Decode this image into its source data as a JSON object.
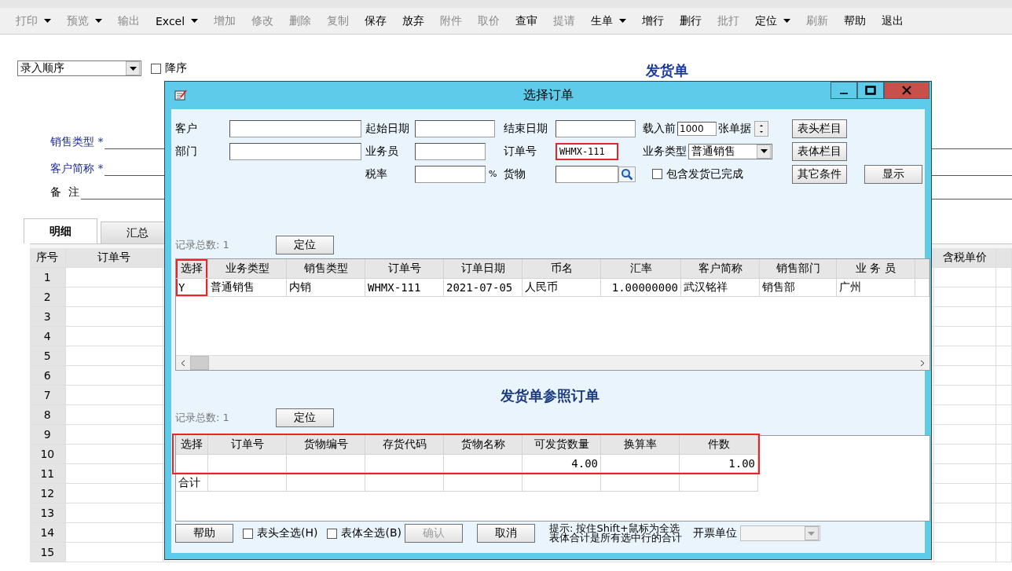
{
  "toolbar": [
    {
      "label": "打印",
      "disabled": true,
      "dropdown": true
    },
    {
      "label": "预览",
      "disabled": true,
      "dropdown": true
    },
    {
      "label": "输出",
      "disabled": true,
      "dropdown": false
    },
    {
      "label": "Excel",
      "disabled": false,
      "dropdown": true
    },
    {
      "label": "增加",
      "disabled": true,
      "dropdown": false
    },
    {
      "label": "修改",
      "disabled": true,
      "dropdown": false
    },
    {
      "label": "删除",
      "disabled": true,
      "dropdown": false
    },
    {
      "label": "复制",
      "disabled": true,
      "dropdown": false
    },
    {
      "label": "保存",
      "disabled": false,
      "dropdown": false
    },
    {
      "label": "放弃",
      "disabled": false,
      "dropdown": false
    },
    {
      "label": "附件",
      "disabled": true,
      "dropdown": false
    },
    {
      "label": "取价",
      "disabled": true,
      "dropdown": false
    },
    {
      "label": "查审",
      "disabled": false,
      "dropdown": false
    },
    {
      "label": "提请",
      "disabled": true,
      "dropdown": false
    },
    {
      "label": "生单",
      "disabled": false,
      "dropdown": true
    },
    {
      "label": "增行",
      "disabled": false,
      "dropdown": false
    },
    {
      "label": "删行",
      "disabled": false,
      "dropdown": false
    },
    {
      "label": "批打",
      "disabled": true,
      "dropdown": false
    },
    {
      "label": "定位",
      "disabled": false,
      "dropdown": true
    },
    {
      "label": "刷新",
      "disabled": true,
      "dropdown": false
    },
    {
      "label": "帮助",
      "disabled": false,
      "dropdown": false
    },
    {
      "label": "退出",
      "disabled": false,
      "dropdown": false
    }
  ],
  "sort": {
    "value": "录入顺序",
    "descending": {
      "label": "降序",
      "checked": false
    }
  },
  "document_title": "发货单",
  "form_fields": [
    {
      "label": "销售类型 *",
      "required": true
    },
    {
      "label": "客户简称 *",
      "required": true
    },
    {
      "label": "备  注",
      "required": false
    }
  ],
  "tabs": [
    {
      "label": "明细",
      "selected": true
    },
    {
      "label": "汇总",
      "selected": false
    }
  ],
  "grid": {
    "columns": [
      "序号",
      "订单号",
      "含税单价"
    ],
    "rows": [
      "1",
      "2",
      "3",
      "4",
      "5",
      "6",
      "7",
      "8",
      "9",
      "10",
      "11",
      "12",
      "13",
      "14",
      "15"
    ]
  },
  "dialog": {
    "title": "选择订单",
    "filter": {
      "customer": {
        "label": "客户"
      },
      "start_date": {
        "label": "起始日期"
      },
      "end_date": {
        "label": "结束日期"
      },
      "load_before": {
        "label": "载入前",
        "value": "1000",
        "unit": "张单据"
      },
      "department": {
        "label": "部门"
      },
      "salesman": {
        "label": "业务员"
      },
      "order_no": {
        "label": "订单号",
        "value": "WHMX-111",
        "highlighted": true
      },
      "biz_type": {
        "label": "业务类型",
        "value": "普通销售"
      },
      "tax_rate": {
        "label": "税率",
        "unit": "%"
      },
      "goods": {
        "label": "货物"
      },
      "include_done": {
        "label": "包含发货已完成",
        "checked": false
      },
      "buttons": [
        "表头栏目",
        "表体栏目",
        "其它条件",
        "显示"
      ]
    },
    "orders": {
      "record_count": "记录总数: 1",
      "locate_button": "定位",
      "columns": [
        {
          "label": "选择",
          "highlighted": true
        },
        {
          "label": "业务类型",
          "highlighted": false
        },
        {
          "label": "销售类型",
          "highlighted": false
        },
        {
          "label": "订单号",
          "highlighted": false
        },
        {
          "label": "订单日期",
          "highlighted": false
        },
        {
          "label": "币名",
          "highlighted": false
        },
        {
          "label": "汇率",
          "highlighted": false
        },
        {
          "label": "客户简称",
          "highlighted": false
        },
        {
          "label": "销售部门",
          "highlighted": false
        },
        {
          "label": "业 务 员",
          "highlighted": false
        }
      ],
      "rows": [
        {
          "cells": [
            "Y",
            "普通销售",
            "内销",
            "WHMX-111",
            "2021-07-05",
            "人民币",
            "1.00000000",
            "武汉铭祥",
            "销售部",
            "广州"
          ]
        }
      ]
    },
    "section_title": "发货单参照订单",
    "details": {
      "record_count": "记录总数: 1",
      "locate_button": "定位",
      "highlighted": true,
      "columns": [
        "选择",
        "订单号",
        "货物编号",
        "存货代码",
        "货物名称",
        "可发货数量",
        "换算率",
        "件数"
      ],
      "rows": [
        {
          "available_qty": "4.00",
          "pieces": "1.00"
        }
      ],
      "total_label": "合计"
    },
    "footer": {
      "help_button": "帮助",
      "checks": [
        {
          "label": "表头全选(H)",
          "checked": false
        },
        {
          "label": "表体全选(B)",
          "checked": false
        }
      ],
      "confirm": {
        "label": "确认",
        "disabled": true
      },
      "cancel_button": "取消",
      "hint": [
        "提示: 按住Shift+鼠标为全选",
        "表体合计是所有选中行的合计"
      ],
      "invoice_unit": {
        "label": "开票单位",
        "disabled": true
      }
    }
  }
}
